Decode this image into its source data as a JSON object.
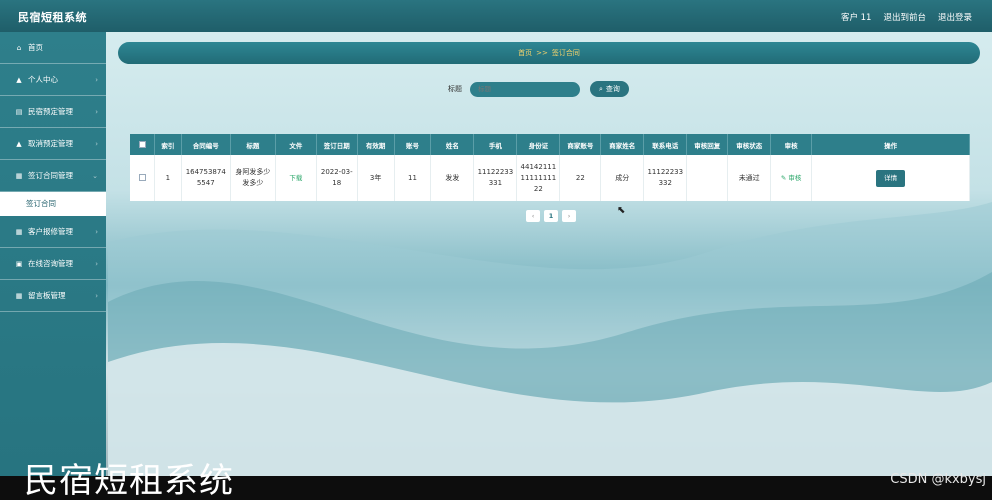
{
  "app": {
    "title": "民宿短租系统",
    "header_links": [
      "客户 11",
      "退出到前台",
      "退出登录"
    ]
  },
  "sidebar": {
    "items": [
      {
        "icon": "home-icon",
        "glyph": "⌂",
        "label": "首页"
      },
      {
        "icon": "user-icon",
        "glyph": "▲",
        "label": "个人中心"
      },
      {
        "icon": "list-icon",
        "glyph": "▤",
        "label": "民宿预定管理"
      },
      {
        "icon": "user-icon",
        "glyph": "▲",
        "label": "取消预定管理"
      },
      {
        "icon": "grid-icon",
        "glyph": "▦",
        "label": "签订合同管理"
      },
      {
        "icon": "",
        "glyph": "",
        "label": "签订合同"
      },
      {
        "icon": "grid-icon",
        "glyph": "▦",
        "label": "客户报修管理"
      },
      {
        "icon": "doc-icon",
        "glyph": "▣",
        "label": "在线咨询管理"
      },
      {
        "icon": "grid-icon",
        "glyph": "▦",
        "label": "留言板管理"
      }
    ]
  },
  "breadcrumb": {
    "home": "首页",
    "separator": ">>",
    "current": "签订合同"
  },
  "search": {
    "label": "标题",
    "placeholder": "标题",
    "button_label": "查询"
  },
  "table": {
    "headers": [
      "",
      "索引",
      "合同编号",
      "标题",
      "文件",
      "签订日期",
      "有效期",
      "账号",
      "姓名",
      "手机",
      "身份证",
      "商家账号",
      "商家姓名",
      "联系电话",
      "审核回复",
      "审核状态",
      "审核",
      "操作"
    ],
    "rows": [
      {
        "index": "1",
        "contract_no": "1647538745547",
        "title": "身阿发多少发多少",
        "file": "下载",
        "sign_date": "2022-03-18",
        "validity": "3年",
        "account": "11",
        "name": "发发",
        "phone": "11122233331",
        "id_card": "441421111111111122",
        "merchant_account": "22",
        "merchant_name": "成分",
        "contact_phone": "11122233332",
        "review_reply": "",
        "review_status": "未通过",
        "review_action": "审核",
        "operation": "详情"
      }
    ]
  },
  "pagination": {
    "prev": "‹",
    "current": "1",
    "next": "›"
  },
  "overlay": {
    "big_title": "民宿短租系统",
    "watermark": "CSDN @kxbysj"
  },
  "colors": {
    "primary": "#2a7480",
    "accent_text": "#f5d36b",
    "success_link": "#2da86b"
  }
}
